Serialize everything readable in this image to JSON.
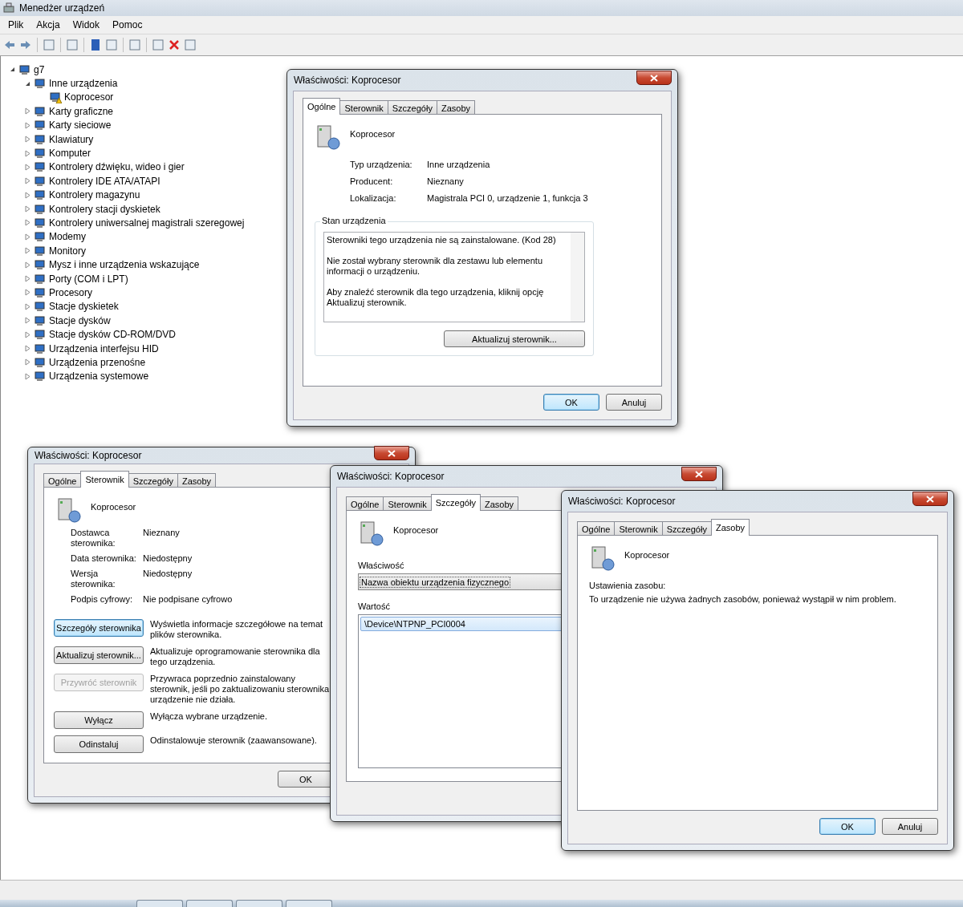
{
  "main_window": {
    "title": "Menedżer urządzeń",
    "menu": [
      "Plik",
      "Akcja",
      "Widok",
      "Pomoc"
    ],
    "tree": {
      "label": "g7",
      "expanded": true,
      "children": [
        {
          "label": "Inne urządzenia",
          "expanded": true,
          "children": [
            {
              "label": "Koprocesor",
              "warning": true
            }
          ]
        },
        {
          "label": "Karty graficzne",
          "expanded": false
        },
        {
          "label": "Karty sieciowe",
          "expanded": false
        },
        {
          "label": "Klawiatury",
          "expanded": false
        },
        {
          "label": "Komputer",
          "expanded": false
        },
        {
          "label": "Kontrolery dźwięku, wideo i gier",
          "expanded": false
        },
        {
          "label": "Kontrolery IDE ATA/ATAPI",
          "expanded": false
        },
        {
          "label": "Kontrolery magazynu",
          "expanded": false
        },
        {
          "label": "Kontrolery stacji dyskietek",
          "expanded": false
        },
        {
          "label": "Kontrolery uniwersalnej magistrali szeregowej",
          "expanded": false
        },
        {
          "label": "Modemy",
          "expanded": false
        },
        {
          "label": "Monitory",
          "expanded": false
        },
        {
          "label": "Mysz i inne urządzenia wskazujące",
          "expanded": false
        },
        {
          "label": "Porty (COM i LPT)",
          "expanded": false
        },
        {
          "label": "Procesory",
          "expanded": false
        },
        {
          "label": "Stacje dyskietek",
          "expanded": false
        },
        {
          "label": "Stacje dysków",
          "expanded": false
        },
        {
          "label": "Stacje dysków CD-ROM/DVD",
          "expanded": false
        },
        {
          "label": "Urządzenia interfejsu HID",
          "expanded": false
        },
        {
          "label": "Urządzenia przenośne",
          "expanded": false
        },
        {
          "label": "Urządzenia systemowe",
          "expanded": false
        }
      ]
    }
  },
  "dialogs": [
    {
      "kind": "general",
      "title": "Właściwości: Koprocesor",
      "tabs": [
        {
          "label": "Ogólne",
          "selected": true
        },
        {
          "label": "Sterownik",
          "selected": false
        },
        {
          "label": "Szczegóły",
          "selected": false
        },
        {
          "label": "Zasoby",
          "selected": false
        }
      ],
      "device_name": "Koprocesor",
      "properties": [
        {
          "label": "Typ urządzenia:",
          "value": "Inne urządzenia"
        },
        {
          "label": "Producent:",
          "value": "Nieznany"
        },
        {
          "label": "Lokalizacja:",
          "value": "Magistrala PCI 0, urządzenie 1, funkcja 3"
        }
      ],
      "status_group": "Stan urządzenia",
      "status_text": [
        "Sterowniki tego urządzenia nie są zainstalowane. (Kod 28)",
        "Nie został wybrany sterownik dla zestawu lub elementu informacji o urządzeniu.",
        "Aby znaleźć sterownik dla tego urządzenia, kliknij opcję Aktualizuj sterownik."
      ],
      "status_button": "Aktualizuj sterownik...",
      "buttons": [
        {
          "label": "OK",
          "default": true
        },
        {
          "label": "Anuluj",
          "default": false
        }
      ]
    },
    {
      "kind": "driver",
      "title": "Właściwości: Koprocesor",
      "tabs": [
        {
          "label": "Ogólne",
          "selected": false
        },
        {
          "label": "Sterownik",
          "selected": true
        },
        {
          "label": "Szczegóły",
          "selected": false
        },
        {
          "label": "Zasoby",
          "selected": false
        }
      ],
      "device_name": "Koprocesor",
      "properties": [
        {
          "label": "Dostawca sterownika:",
          "value": "Nieznany"
        },
        {
          "label": "Data sterownika:",
          "value": "Niedostępny"
        },
        {
          "label": "Wersja sterownika:",
          "value": "Niedostępny"
        },
        {
          "label": "Podpis cyfrowy:",
          "value": "Nie podpisane cyfrowo"
        }
      ],
      "actions": [
        {
          "button": "Szczegóły sterownika",
          "description": "Wyświetla informacje szczegółowe na temat plików sterownika.",
          "disabled": false,
          "focused": true
        },
        {
          "button": "Aktualizuj sterownik...",
          "description": "Aktualizuje oprogramowanie sterownika dla tego urządzenia.",
          "disabled": false,
          "focused": false
        },
        {
          "button": "Przywróć sterownik",
          "description": "Przywraca poprzednio zainstalowany sterownik, jeśli po zaktualizowaniu sterownika urządzenie nie działa.",
          "disabled": true,
          "focused": false
        },
        {
          "button": "Wyłącz",
          "description": "Wyłącza wybrane urządzenie.",
          "disabled": false,
          "focused": false
        },
        {
          "button": "Odinstaluj",
          "description": "Odinstalowuje sterownik (zaawansowane).",
          "disabled": false,
          "focused": false
        }
      ],
      "buttons": [
        {
          "label": "OK"
        }
      ]
    },
    {
      "kind": "details",
      "title": "Właściwości: Koprocesor",
      "tabs": [
        {
          "label": "Ogólne",
          "selected": false
        },
        {
          "label": "Sterownik",
          "selected": false
        },
        {
          "label": "Szczegóły",
          "selected": true
        },
        {
          "label": "Zasoby",
          "selected": false
        }
      ],
      "device_name": "Koprocesor",
      "property_label": "Właściwość",
      "property_value": "Nazwa obiektu urządzenia fizycznego",
      "value_label": "Wartość",
      "values": [
        {
          "text": "\\Device\\NTPNP_PCI0004",
          "selected": true
        }
      ]
    },
    {
      "kind": "resources",
      "title": "Właściwości: Koprocesor",
      "tabs": [
        {
          "label": "Ogólne",
          "selected": false
        },
        {
          "label": "Sterownik",
          "selected": false
        },
        {
          "label": "Szczegóły",
          "selected": false
        },
        {
          "label": "Zasoby",
          "selected": true
        }
      ],
      "device_name": "Koprocesor",
      "settings_label": "Ustawienia zasobu:",
      "message": "To urządzenie nie używa żadnych zasobów, ponieważ wystąpił w nim problem.",
      "buttons": [
        {
          "label": "OK",
          "default": true
        },
        {
          "label": "Anuluj",
          "default": false
        }
      ]
    }
  ]
}
